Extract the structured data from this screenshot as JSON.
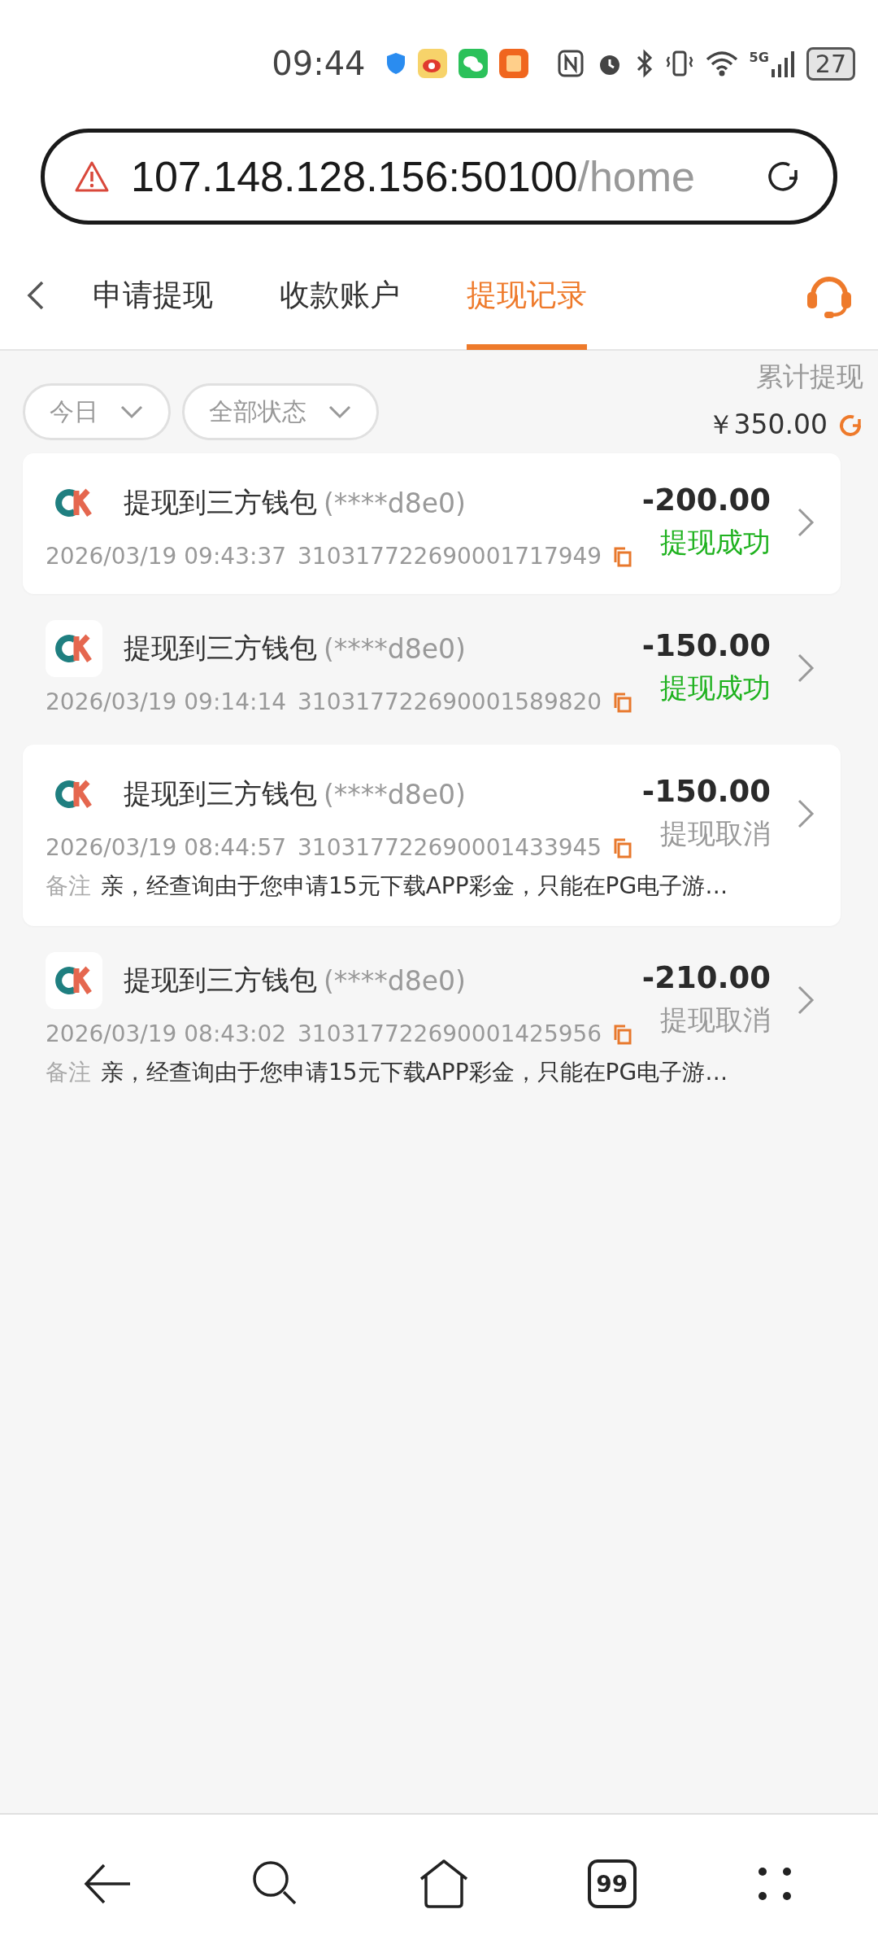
{
  "status_bar": {
    "time": "09:44",
    "battery": "27",
    "network": "5G"
  },
  "address_bar": {
    "host": "107.148.128.156:50100",
    "path": "/home"
  },
  "tabs": [
    {
      "label": "申请提现",
      "selected": false
    },
    {
      "label": "收款账户",
      "selected": false
    },
    {
      "label": "提现记录",
      "selected": true
    }
  ],
  "filters": [
    {
      "label": "今日"
    },
    {
      "label": "全部状态"
    }
  ],
  "total": {
    "label": "累计提现",
    "amount": "￥350.00"
  },
  "records": [
    {
      "title": "提现到三方钱包",
      "account": "(****d8e0)",
      "time": "2026/03/19 09:43:37",
      "order_no": "310317722690001717949",
      "amount": "-200.00",
      "status": "提现成功",
      "kind": "success"
    },
    {
      "title": "提现到三方钱包",
      "account": "(****d8e0)",
      "time": "2026/03/19 09:14:14",
      "order_no": "310317722690001589820",
      "amount": "-150.00",
      "status": "提现成功",
      "kind": "success"
    },
    {
      "title": "提现到三方钱包",
      "account": "(****d8e0)",
      "time": "2026/03/19 08:44:57",
      "order_no": "310317722690001433945",
      "amount": "-150.00",
      "status": "提现取消",
      "kind": "cancelled",
      "note_label": "备注",
      "note": "亲，经查询由于您申请15元下载APP彩金，只能在PG电子游…"
    },
    {
      "title": "提现到三方钱包",
      "account": "(****d8e0)",
      "time": "2026/03/19 08:43:02",
      "order_no": "310317722690001425956",
      "amount": "-210.00",
      "status": "提现取消",
      "kind": "cancelled",
      "note_label": "备注",
      "note": "亲，经查询由于您申请15元下载APP彩金，只能在PG电子游…"
    }
  ],
  "bottom_nav": {
    "tab_count": "99"
  }
}
